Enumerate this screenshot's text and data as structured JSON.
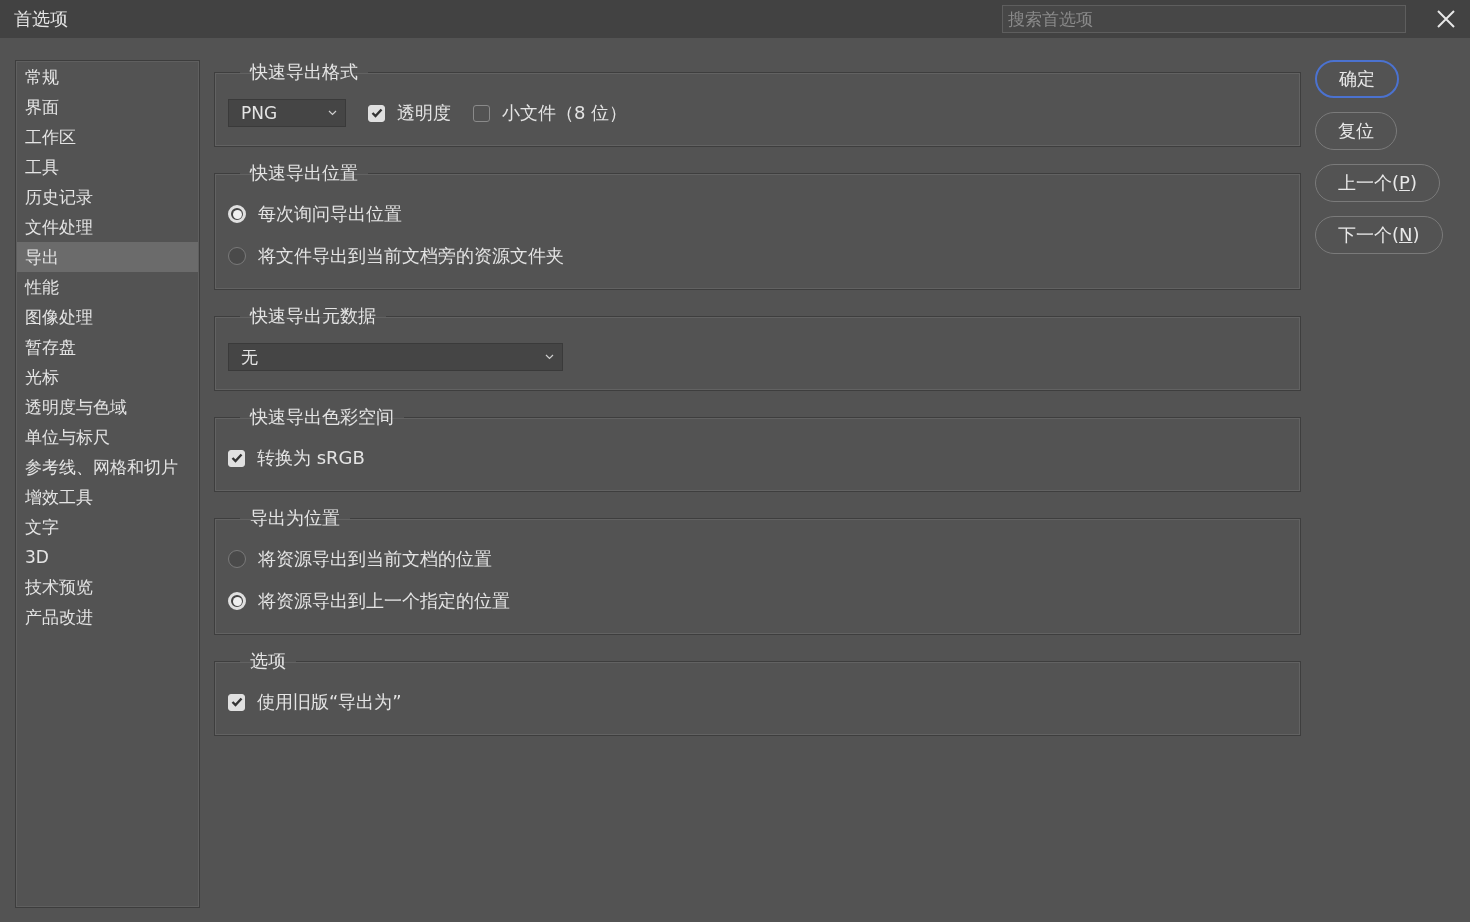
{
  "window": {
    "title": "首选项"
  },
  "search": {
    "placeholder": "搜索首选项"
  },
  "sidebar": {
    "items": [
      {
        "label": "常规",
        "selected": false
      },
      {
        "label": "界面",
        "selected": false
      },
      {
        "label": "工作区",
        "selected": false
      },
      {
        "label": "工具",
        "selected": false
      },
      {
        "label": "历史记录",
        "selected": false
      },
      {
        "label": "文件处理",
        "selected": false
      },
      {
        "label": "导出",
        "selected": true
      },
      {
        "label": "性能",
        "selected": false
      },
      {
        "label": "图像处理",
        "selected": false
      },
      {
        "label": "暂存盘",
        "selected": false
      },
      {
        "label": "光标",
        "selected": false
      },
      {
        "label": "透明度与色域",
        "selected": false
      },
      {
        "label": "单位与标尺",
        "selected": false
      },
      {
        "label": "参考线、网格和切片",
        "selected": false
      },
      {
        "label": "增效工具",
        "selected": false
      },
      {
        "label": "文字",
        "selected": false
      },
      {
        "label": "3D",
        "selected": false
      },
      {
        "label": "技术预览",
        "selected": false
      },
      {
        "label": "产品改进",
        "selected": false
      }
    ]
  },
  "sections": [
    {
      "title": "快速导出格式",
      "rows": [
        [
          {
            "kind": "select",
            "value": "PNG"
          },
          {
            "kind": "checkbox",
            "label": "透明度",
            "checked": true
          },
          {
            "kind": "checkbox",
            "label": "小文件（8 位）",
            "checked": false
          }
        ]
      ]
    },
    {
      "title": "快速导出位置",
      "rows": [
        [
          {
            "kind": "radio",
            "label": "每次询问导出位置",
            "selected": true
          }
        ],
        [
          {
            "kind": "radio",
            "label": "将文件导出到当前文档旁的资源文件夹",
            "selected": false
          }
        ]
      ]
    },
    {
      "title": "快速导出元数据",
      "rows": [
        [
          {
            "kind": "select",
            "value": "无"
          }
        ]
      ]
    },
    {
      "title": "快速导出色彩空间",
      "rows": [
        [
          {
            "kind": "checkbox",
            "label": "转换为 sRGB",
            "checked": true
          }
        ]
      ]
    },
    {
      "title": "导出为位置",
      "rows": [
        [
          {
            "kind": "radio",
            "label": "将资源导出到当前文档的位置",
            "selected": false
          }
        ],
        [
          {
            "kind": "radio",
            "label": "将资源导出到上一个指定的位置",
            "selected": true
          }
        ]
      ]
    },
    {
      "title": "选项",
      "rows": [
        [
          {
            "kind": "checkbox",
            "label": "使用旧版“导出为”",
            "checked": true
          }
        ]
      ]
    }
  ],
  "buttons": [
    {
      "label": "确定",
      "default": true
    },
    {
      "label": "复位",
      "default": false
    },
    {
      "label": "上一个(",
      "mnemonic": "P",
      "after": ")",
      "default": false
    },
    {
      "label": "下一个(",
      "mnemonic": "N",
      "after": ")",
      "default": false
    }
  ]
}
